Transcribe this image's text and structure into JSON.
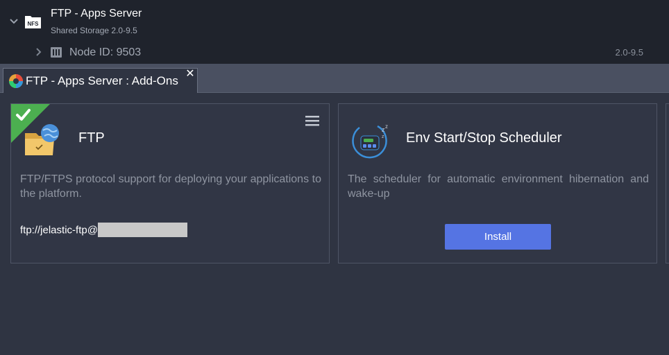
{
  "tree": {
    "environment": {
      "name": "FTP - Apps Server",
      "subtitle": "Shared Storage 2.0-9.5",
      "icon": "nfs-icon",
      "icon_text": "NFS"
    },
    "node": {
      "label": "Node ID: 9503",
      "version": "2.0-9.5",
      "icon": "server-node-icon"
    }
  },
  "tabs": [
    {
      "label": "FTP - Apps Server : Add-Ons",
      "icon": "addons-icon",
      "close_glyph": "✕"
    }
  ],
  "addons": [
    {
      "title": "FTP",
      "description": "FTP/FTPS protocol support for deploying your applications to the platform.",
      "url": "ftp://jelastic-ftp@",
      "installed": true,
      "icon": "ftp-folder-icon"
    },
    {
      "title": "Env Start/Stop Scheduler",
      "description": "The scheduler for automatic environment hibernation and wake-up",
      "button_label": "Install",
      "installed": false,
      "icon": "scheduler-icon"
    }
  ],
  "colors": {
    "tree_bg": "#1f232c",
    "tabbar_bg": "#4a5061",
    "content_bg": "#2f3442",
    "installed_badge": "#4caf50",
    "install_button": "#5574e3"
  }
}
